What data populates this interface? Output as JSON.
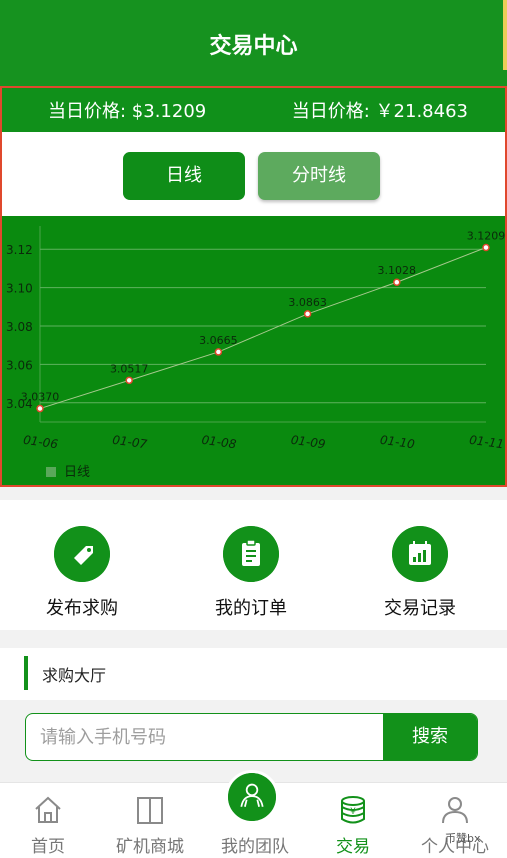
{
  "header": {
    "title": "交易中心"
  },
  "prices": {
    "usd": "当日价格: $3.1209",
    "cny": "当日价格: ￥21.8463"
  },
  "chart_tabs": {
    "day": "日线",
    "minute": "分时线"
  },
  "chart_data": {
    "type": "line",
    "categories": [
      "01-06",
      "01-07",
      "01-08",
      "01-09",
      "01-10",
      "01-11"
    ],
    "series": [
      {
        "name": "日线",
        "values": [
          3.037,
          3.0517,
          3.0665,
          3.0863,
          3.1028,
          3.1209
        ]
      }
    ],
    "data_labels": [
      "3.0370",
      "3.0517",
      "3.0665",
      "3.0863",
      "3.1028",
      "3.1209"
    ],
    "y_ticks": [
      "3.04",
      "3.06",
      "3.08",
      "3.10",
      "3.12"
    ],
    "ylim": [
      3.03,
      3.13
    ],
    "grid": true,
    "legend": "bottom-left",
    "colors": {
      "background": "#0a8a0f",
      "line": "#a7c98e",
      "point": "#e0482d"
    }
  },
  "actions": [
    {
      "label": "发布求购",
      "icon": "tag-icon"
    },
    {
      "label": "我的订单",
      "icon": "clipboard-icon"
    },
    {
      "label": "交易记录",
      "icon": "calendar-chart-icon"
    }
  ],
  "hall": {
    "title": "求购大厅"
  },
  "search": {
    "placeholder": "请输入手机号码",
    "button": "搜索"
  },
  "tabbar": [
    {
      "label": "首页",
      "icon": "home-icon"
    },
    {
      "label": "矿机商城",
      "icon": "door-icon"
    },
    {
      "label": "我的团队",
      "icon": "team-icon"
    },
    {
      "label": "交易",
      "icon": "coin-stack-icon"
    },
    {
      "label": "个人中心",
      "icon": "user-icon"
    }
  ],
  "watermark": "币赞bx",
  "colors": {
    "brand": "#12911a",
    "highlight": "#e0482d"
  }
}
